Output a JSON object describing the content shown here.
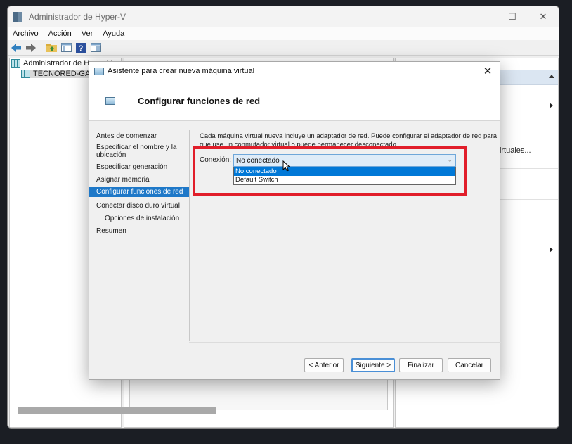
{
  "window": {
    "title": "Administrador de Hyper-V",
    "controls": {
      "minimize": "—",
      "maximize": "☐",
      "close": "✕"
    }
  },
  "menu": [
    "Archivo",
    "Acción",
    "Ver",
    "Ayuda"
  ],
  "toolbar": {
    "icons": [
      "back-icon",
      "forward-icon",
      "folder-up-icon",
      "show-tree-icon",
      "help-icon",
      "console-icon"
    ]
  },
  "tree": {
    "root": "Administrador de Hyper-V",
    "child": "TECNORED-GAME"
  },
  "actions_pane": {
    "items": [
      "ores virtuales..."
    ]
  },
  "dialog": {
    "title": "Asistente para crear nueva máquina virtual",
    "close": "✕",
    "header_title": "Configurar funciones de red",
    "nav_items": [
      "Antes de comenzar",
      "Especificar el nombre y la",
      "ubicación",
      "Especificar generación",
      "Asignar memoria",
      "Configurar funciones de red",
      "Conectar disco duro virtual",
      "Opciones de instalación",
      "Resumen"
    ],
    "description_line1": "Cada máquina virtual nueva incluye un adaptador de red. Puede configurar el adaptador de red para",
    "description_line2": "que use un conmutador virtual o puede permanecer desconectado.",
    "connection_label": "Conexión:",
    "connection_value": "No conectado",
    "connection_options": [
      "No conectado",
      "Default Switch"
    ],
    "buttons": {
      "previous": "< Anterior",
      "next": "Siguiente >",
      "finish": "Finalizar",
      "cancel": "Cancelar"
    }
  },
  "colors": {
    "selection": "#1e78c8",
    "highlight_box": "#e11e2a",
    "dropdown_highlight": "#0078d7"
  }
}
